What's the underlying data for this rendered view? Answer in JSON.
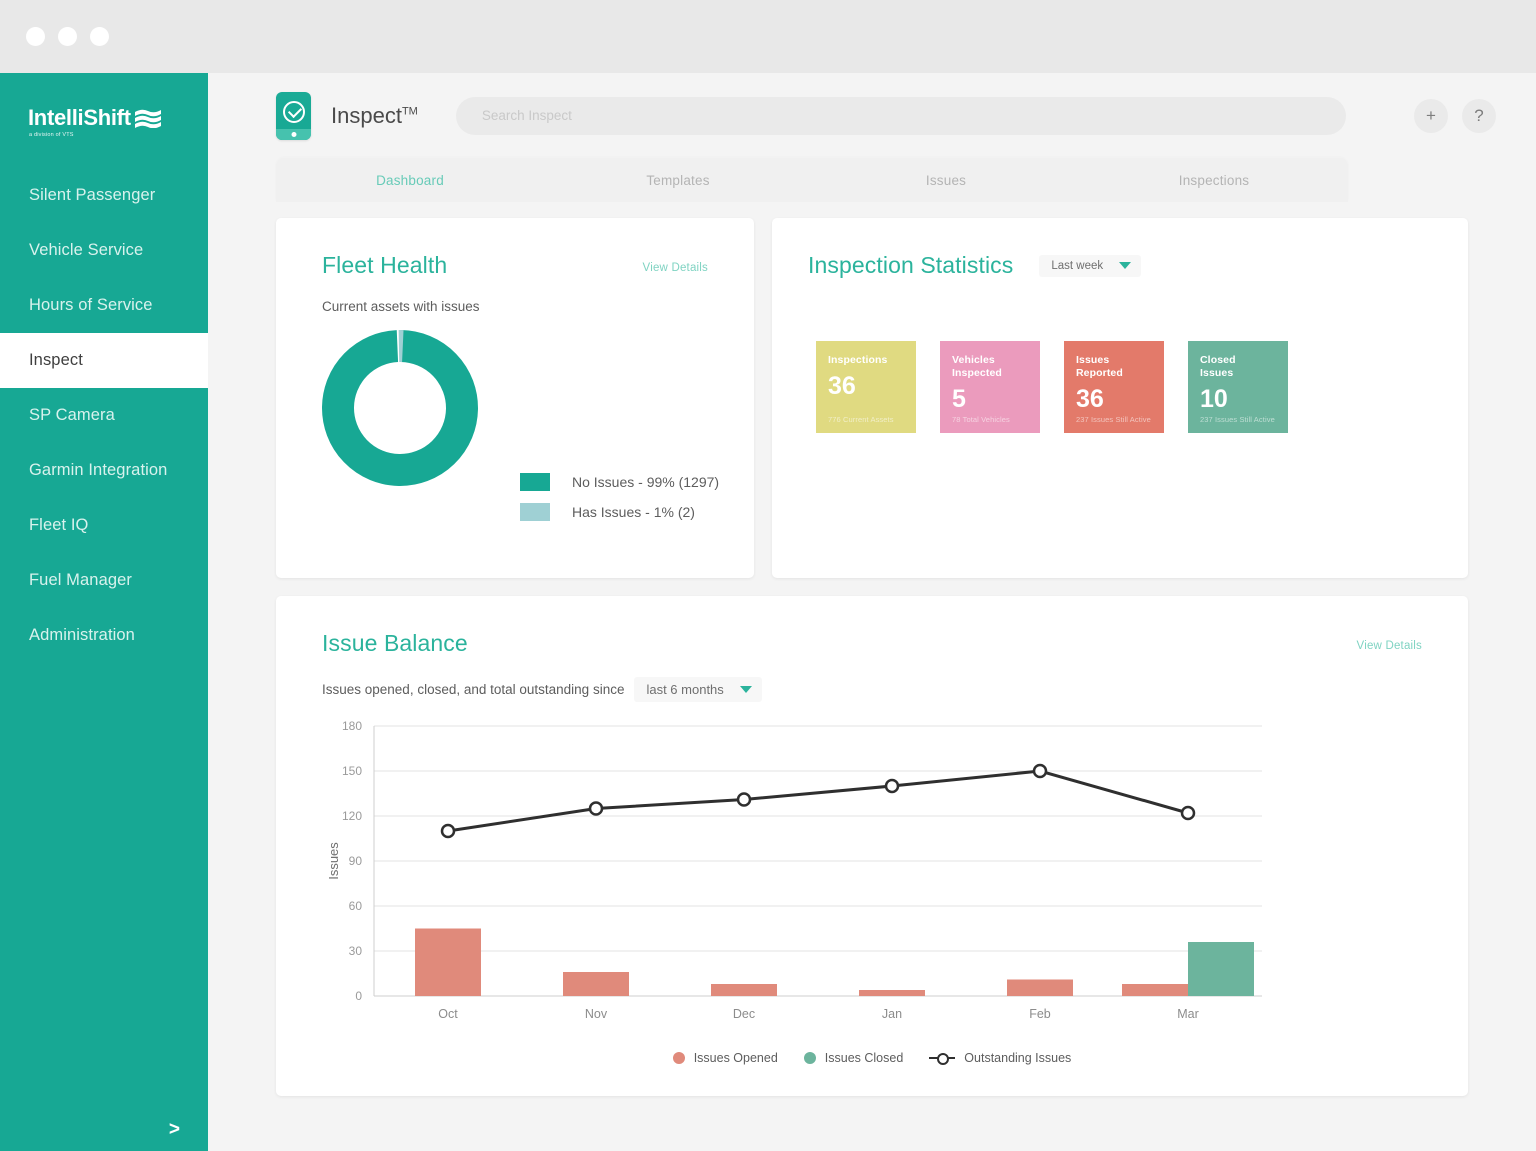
{
  "window": {
    "dots": [
      "",
      "",
      ""
    ]
  },
  "sidebar": {
    "brand": "IntelliShift",
    "brand_sub": "a division of VTS",
    "expand_icon": ">",
    "items": [
      {
        "label": "Silent Passenger",
        "active": false
      },
      {
        "label": "Vehicle Service",
        "active": false
      },
      {
        "label": "Hours of Service",
        "active": false
      },
      {
        "label": "Inspect",
        "active": true
      },
      {
        "label": "SP Camera",
        "active": false
      },
      {
        "label": "Garmin Integration",
        "active": false
      },
      {
        "label": "Fleet IQ",
        "active": false
      },
      {
        "label": "Fuel Manager",
        "active": false
      },
      {
        "label": "Administration",
        "active": false
      }
    ]
  },
  "topbar": {
    "app_title": "Inspect",
    "app_title_tm": "TM",
    "search_placeholder": "Search Inspect",
    "search_value": "",
    "add_label": "+",
    "help_label": "?"
  },
  "tabs": [
    {
      "label": "Dashboard",
      "active": true
    },
    {
      "label": "Templates",
      "active": false
    },
    {
      "label": "Issues",
      "active": false
    },
    {
      "label": "Inspections",
      "active": false
    }
  ],
  "fleet_health": {
    "title": "Fleet Health",
    "view_details": "View Details",
    "subtitle": "Current assets with issues",
    "legend": [
      {
        "label": "No Issues - 99% (1297)",
        "color": "#17a894"
      },
      {
        "label": "Has Issues - 1% (2)",
        "color": "#9fd0d4"
      }
    ]
  },
  "inspection_statistics": {
    "title": "Inspection Statistics",
    "period": "Last week",
    "tiles": [
      {
        "label": "Inspections",
        "value": "36",
        "note": "776 Current Assets",
        "color": "#e0da81"
      },
      {
        "label": "Vehicles\nInspected",
        "value": "5",
        "note": "78 Total Vehicles",
        "color": "#eb9bbd"
      },
      {
        "label": "Issues\nReported",
        "value": "36",
        "note": "237 Issues Still Active",
        "color": "#e37a6a"
      },
      {
        "label": "Closed\nIssues",
        "value": "10",
        "note": "237 Issues Still Active",
        "color": "#6cb49d"
      }
    ]
  },
  "issue_balance": {
    "title": "Issue Balance",
    "view_details": "View Details",
    "subtitle": "Issues opened, closed, and total outstanding since",
    "period": "last 6 months"
  },
  "chart_data": {
    "type": "bar",
    "title": "Issue Balance",
    "xlabel": "",
    "ylabel": "Issues",
    "ylim": [
      0,
      180
    ],
    "yticks": [
      0,
      30,
      60,
      90,
      120,
      150,
      180
    ],
    "grid": true,
    "legend_position": "bottom",
    "categories": [
      "Oct",
      "Nov",
      "Dec",
      "Jan",
      "Feb",
      "Mar"
    ],
    "series": [
      {
        "name": "Issues Opened",
        "type": "bar",
        "color": "#e08a7b",
        "values": [
          45,
          16,
          8,
          4,
          11,
          8
        ]
      },
      {
        "name": "Issues Closed",
        "type": "bar",
        "color": "#6cb49d",
        "values": [
          0,
          0,
          0,
          0,
          0,
          36
        ]
      },
      {
        "name": "Outstanding Issues",
        "type": "line",
        "color": "#2f2f2f",
        "values": [
          110,
          125,
          131,
          140,
          150,
          122
        ]
      }
    ]
  },
  "colors": {
    "brand_teal": "#17a894",
    "accent_green": "#2bb39c",
    "bar_red": "#e08a7b",
    "bar_green": "#6cb49d",
    "line_dark": "#2f2f2f"
  }
}
